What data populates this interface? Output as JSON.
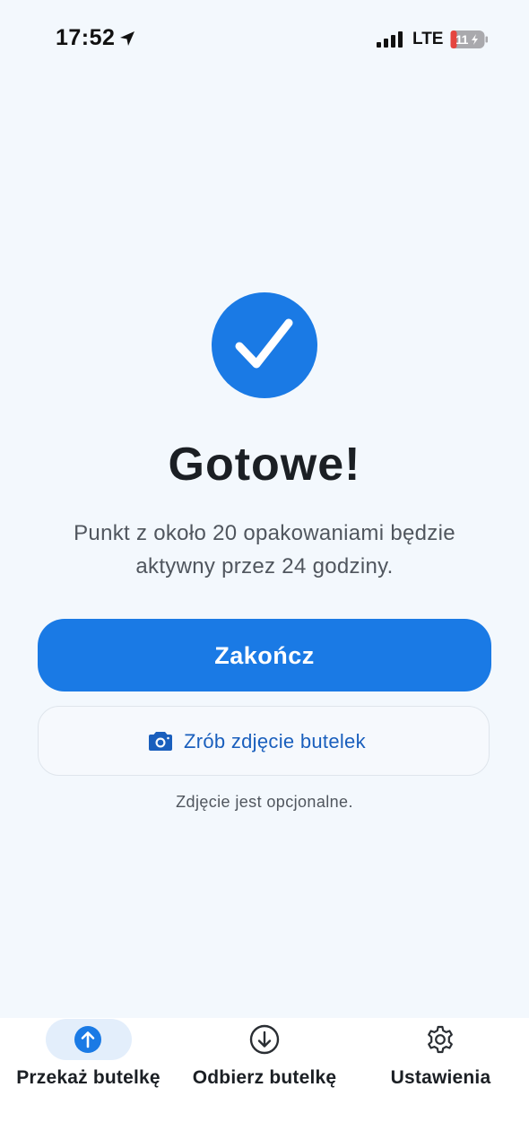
{
  "status_bar": {
    "time": "17:52",
    "network": "LTE",
    "battery": "11",
    "icons": [
      "location-arrow-icon",
      "signal-icon",
      "battery-charging-icon"
    ]
  },
  "main": {
    "title": "Gotowe!",
    "description": "Punkt z około 20 opakowaniami będzie aktywny przez 24 godziny.",
    "primary_button": "Zakończ",
    "secondary_button": "Zrób zdjęcie butelek",
    "note": "Zdjęcie jest opcjonalne.",
    "icons": [
      "checkmark-icon",
      "camera-icon"
    ]
  },
  "tab_bar": {
    "tabs": [
      {
        "label": "Przekaż butelkę",
        "icon": "arrow-up-circle-icon",
        "active": true
      },
      {
        "label": "Odbierz butelkę",
        "icon": "arrow-down-circle-icon",
        "active": false
      },
      {
        "label": "Ustawienia",
        "icon": "gear-icon",
        "active": false
      }
    ]
  },
  "colors": {
    "accent": "#1a7ae5",
    "background": "#f3f8fd",
    "secondary_text": "#1a5fbd",
    "battery_low": "#e5453f"
  }
}
